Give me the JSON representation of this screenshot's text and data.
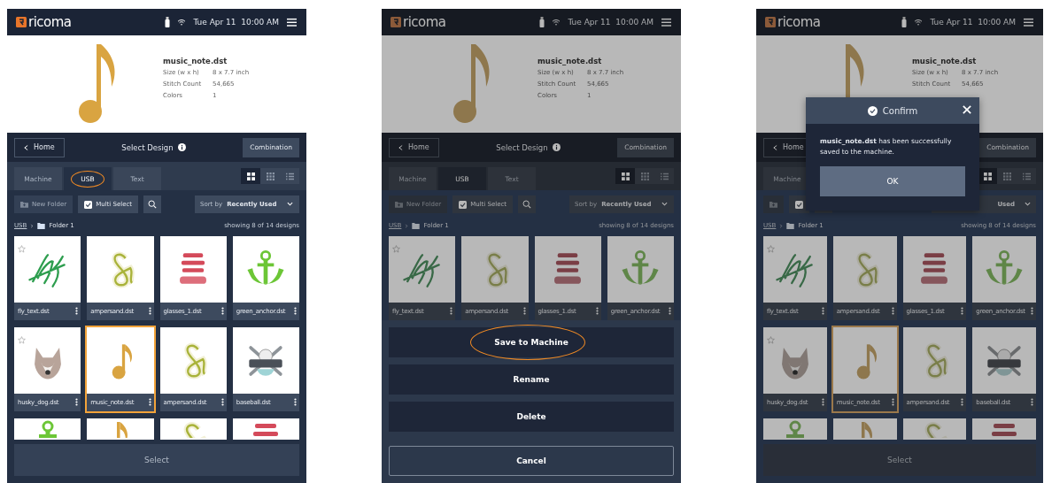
{
  "screens": [
    {
      "dimmed": false,
      "status": {
        "brand": "ricoma",
        "datetime": "Tue Apr 11  10:00 AM"
      },
      "design": {
        "file": "music_note.dst",
        "specs": [
          {
            "label": "Size (w x h)",
            "value": "8 x 7.7 inch"
          },
          {
            "label": "Stitch Count",
            "value": "54,665"
          },
          {
            "label": "Colors",
            "value": "1"
          }
        ]
      },
      "nav": {
        "back": "Home",
        "title": "Select Design",
        "action": "Combination"
      },
      "tabs": [
        {
          "label": "Machine",
          "selected": false,
          "annotated": false
        },
        {
          "label": "USB",
          "selected": true,
          "annotated": true
        },
        {
          "label": "Text",
          "selected": false,
          "annotated": false
        }
      ],
      "views": [
        {
          "kind": "large",
          "selected": true
        },
        {
          "kind": "small",
          "selected": false
        },
        {
          "kind": "list",
          "selected": false
        }
      ],
      "toolbar": {
        "new_folder": {
          "label": "New Folder",
          "disabled": true
        },
        "multi_select": "Multi Select",
        "sort": {
          "label": "Sort by",
          "value": "Recently Used"
        }
      },
      "breadcrumb": {
        "root": "USB",
        "folder": "Folder 1",
        "count": "showing 8 of 14 designs"
      },
      "cards": [
        {
          "name": "fly_text.dst",
          "kind": "fly",
          "selected": false
        },
        {
          "name": "ampersand.dst",
          "kind": "ampersand",
          "selected": false
        },
        {
          "name": "glasses_1.dst",
          "kind": "love",
          "selected": false
        },
        {
          "name": "green_anchor.dst",
          "kind": "anchor",
          "selected": false
        },
        {
          "name": "husky_dog.dst",
          "kind": "husky",
          "selected": false
        },
        {
          "name": "music_note.dst",
          "kind": "note",
          "selected": true
        },
        {
          "name": "ampersand.dst",
          "kind": "ampersand",
          "selected": false
        },
        {
          "name": "baseball.dst",
          "kind": "baseball",
          "selected": false
        }
      ],
      "more_cards": [
        {
          "kind": "anchor"
        },
        {
          "kind": "note"
        },
        {
          "kind": "ampersand"
        },
        {
          "kind": "love"
        }
      ],
      "footer": {
        "kind": "select",
        "label": "Select",
        "disabled": true
      }
    },
    {
      "dimmed": true,
      "status": {
        "brand": "ricoma",
        "datetime": "Tue Apr 11  10:00 AM"
      },
      "design": {
        "file": "music_note.dst",
        "specs": [
          {
            "label": "Size (w x h)",
            "value": "8 x 7.7 inch"
          },
          {
            "label": "Stitch Count",
            "value": "54,665"
          },
          {
            "label": "Colors",
            "value": "1"
          }
        ]
      },
      "nav": {
        "back": "Home",
        "title": "Select Design",
        "action": "Combination"
      },
      "tabs": [
        {
          "label": "Machine",
          "selected": false,
          "annotated": false
        },
        {
          "label": "USB",
          "selected": true,
          "annotated": false
        },
        {
          "label": "Text",
          "selected": false,
          "annotated": false
        }
      ],
      "views": [
        {
          "kind": "large",
          "selected": true
        },
        {
          "kind": "small",
          "selected": false
        },
        {
          "kind": "list",
          "selected": false
        }
      ],
      "toolbar": {
        "new_folder": {
          "label": "New Folder",
          "disabled": true
        },
        "multi_select": "Multi Select",
        "sort": {
          "label": "Sort by",
          "value": "Recently Used"
        }
      },
      "breadcrumb": {
        "root": "USB",
        "folder": "Folder 1",
        "count": "showing 8 of 14 designs"
      },
      "cards": [
        {
          "name": "fly_text.dst",
          "kind": "fly",
          "selected": false
        },
        {
          "name": "ampersand.dst",
          "kind": "ampersand",
          "selected": false
        },
        {
          "name": "glasses_1.dst",
          "kind": "love",
          "selected": false
        },
        {
          "name": "green_anchor.dst",
          "kind": "anchor",
          "selected": false
        }
      ],
      "footer": {
        "kind": "sheet",
        "actions": [
          {
            "label": "Save to Machine",
            "annotated": true
          },
          {
            "label": "Rename",
            "annotated": false
          },
          {
            "label": "Delete",
            "annotated": false
          }
        ],
        "cancel": "Cancel"
      }
    },
    {
      "dimmed": true,
      "status": {
        "brand": "ricoma",
        "datetime": "Tue Apr 11  10:00 AM"
      },
      "design": {
        "file": "music_note.dst",
        "specs": [
          {
            "label": "Size (w x h)",
            "value": "8 x 7.7 inch"
          },
          {
            "label": "Stitch Count",
            "value": "54,665"
          }
        ]
      },
      "nav": {
        "back": "Home",
        "action": "Combination"
      },
      "tabs": [
        {
          "label": "Machine",
          "selected": false,
          "annotated": false
        }
      ],
      "views": [
        {
          "kind": "large",
          "selected": true
        },
        {
          "kind": "small",
          "selected": false
        },
        {
          "kind": "list",
          "selected": false
        }
      ],
      "toolbar": {
        "new_folder": {
          "disabled": true
        },
        "sort": {
          "value": "Used"
        }
      },
      "breadcrumb": {
        "root": "USB",
        "folder": "Folder 1",
        "count": "showing 8 of 14 designs"
      },
      "cards": [
        {
          "name": "fly_text.dst",
          "kind": "fly",
          "selected": false
        },
        {
          "name": "ampersand.dst",
          "kind": "ampersand",
          "selected": false
        },
        {
          "name": "glasses_1.dst",
          "kind": "love",
          "selected": false
        },
        {
          "name": "green_anchor.dst",
          "kind": "anchor",
          "selected": false
        },
        {
          "name": "husky_dog.dst",
          "kind": "husky",
          "selected": false
        },
        {
          "name": "music_note.dst",
          "kind": "note",
          "selected": true
        },
        {
          "name": "ampersand.dst",
          "kind": "ampersand",
          "selected": false
        },
        {
          "name": "baseball.dst",
          "kind": "baseball",
          "selected": false
        }
      ],
      "more_cards": [
        {
          "kind": "anchor"
        },
        {
          "kind": "note"
        },
        {
          "kind": "ampersand"
        },
        {
          "kind": "love"
        }
      ],
      "footer": {
        "kind": "select",
        "label": "Select",
        "disabled": true
      },
      "dialog": {
        "title": "Confirm",
        "message": "**music_note.dst** has been successfully saved to the machine.",
        "button": "OK"
      }
    }
  ]
}
